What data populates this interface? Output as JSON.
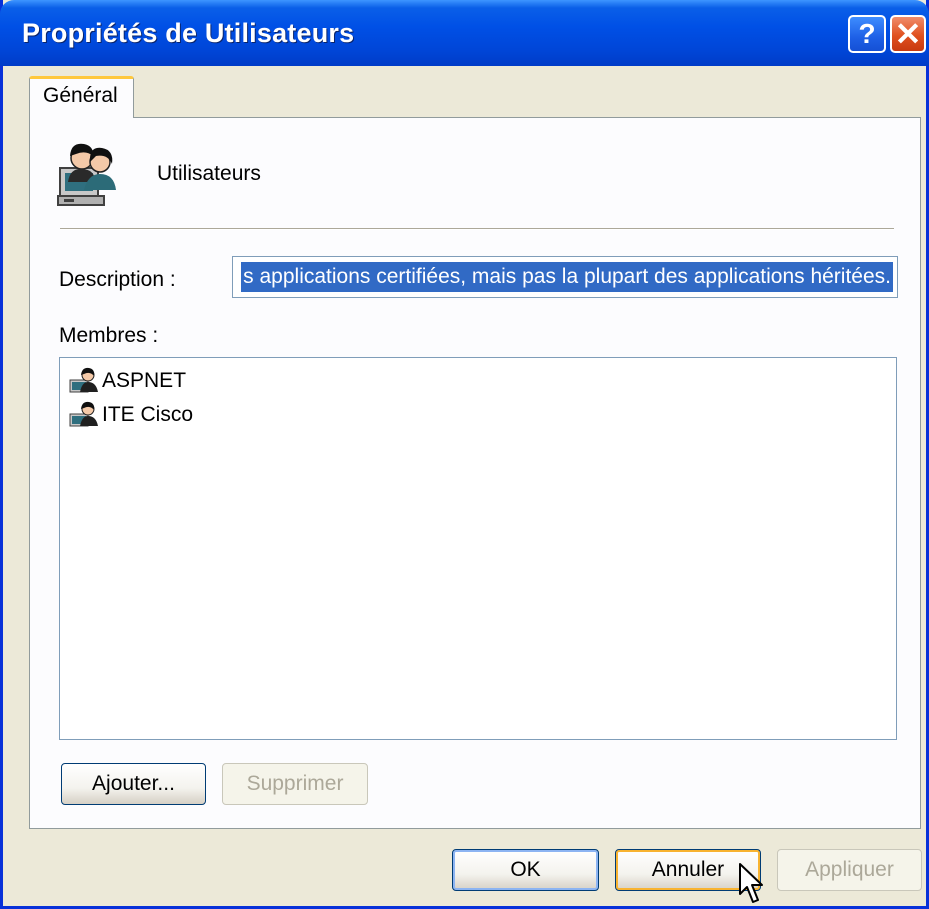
{
  "window": {
    "title": "Propriétés de Utilisateurs",
    "help_label": "?",
    "close_label": "✕"
  },
  "tabs": [
    {
      "label": "Général",
      "active": true
    }
  ],
  "general": {
    "group_name": "Utilisateurs",
    "group_icon": "users-group-icon",
    "description_label": "Description :",
    "description_value": "s applications certifiées, mais pas la plupart des applications héritées.",
    "members_label": "Membres :",
    "members": [
      {
        "name": "ASPNET",
        "icon": "user-icon"
      },
      {
        "name": "ITE Cisco",
        "icon": "user-icon"
      }
    ],
    "add_button": "Ajouter...",
    "remove_button": "Supprimer"
  },
  "footer": {
    "ok_button": "OK",
    "cancel_button": "Annuler",
    "apply_button": "Appliquer"
  },
  "colors": {
    "title_bar": "#0050e6",
    "selection": "#316ac5",
    "tab_highlight": "#ffc83c"
  }
}
